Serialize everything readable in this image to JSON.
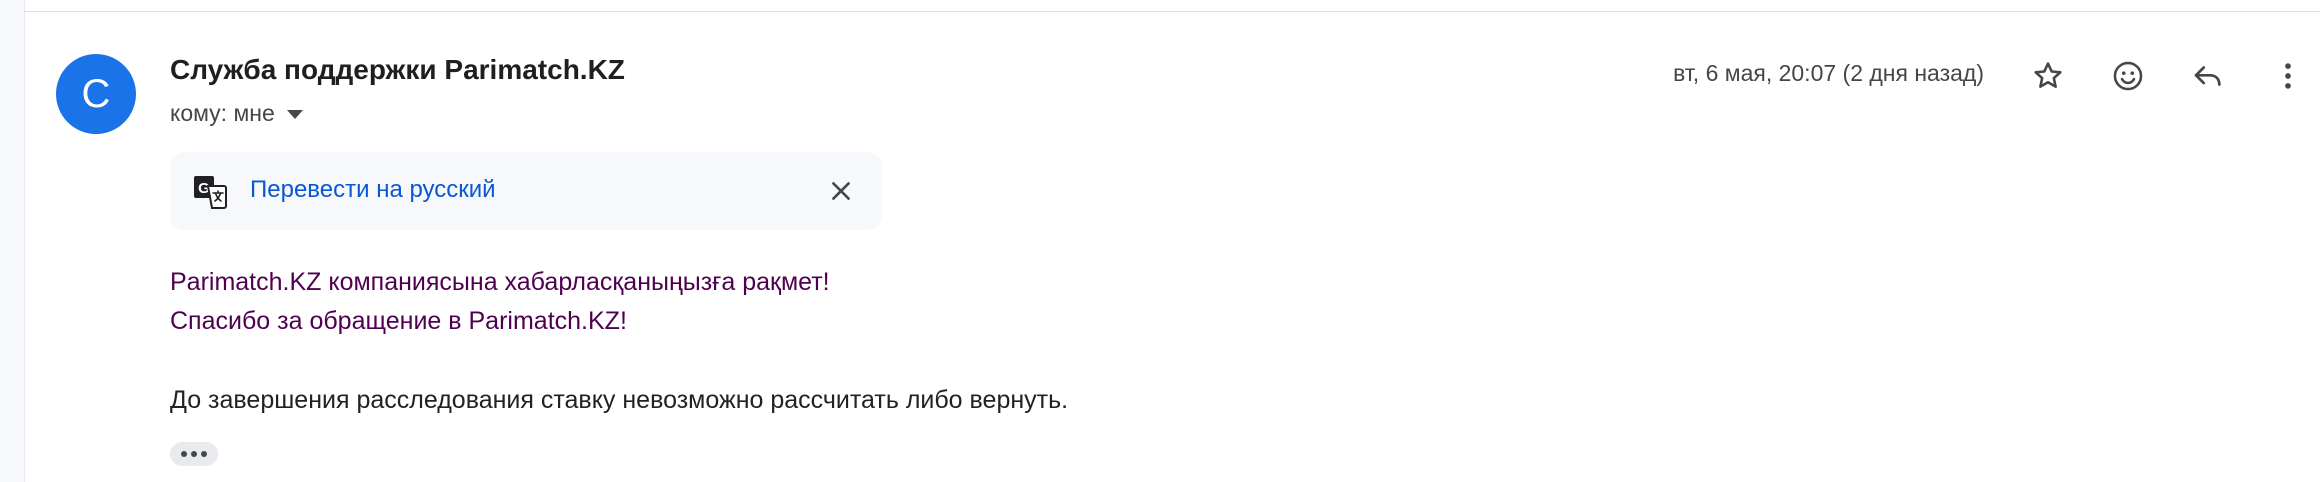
{
  "email": {
    "avatar_letter": "С",
    "avatar_color": "#1a73e8",
    "sender_name": "Служба поддержки Parimatch.KZ",
    "recipient_label": "кому: мне",
    "date": "вт, 6 мая, 20:07 (2 дня назад)"
  },
  "actions": {
    "icons": [
      "star-icon",
      "emoji-icon",
      "reply-icon",
      "more-vert-icon"
    ]
  },
  "translate_bar": {
    "icon": "translate-icon",
    "link_label": "Перевести на русский",
    "close_icon": "close-icon"
  },
  "body": {
    "line1": "Parimatch.KZ компаниясына хабарласқаныңызға рақмет!",
    "line2": "Спасибо за обращение в Parimatch.KZ!",
    "line3": "До завершения расследования ставку невозможно рассчитать либо вернуть."
  },
  "colors": {
    "quoted_text": "#500050",
    "link": "#0b57d0",
    "text": "#222222"
  }
}
